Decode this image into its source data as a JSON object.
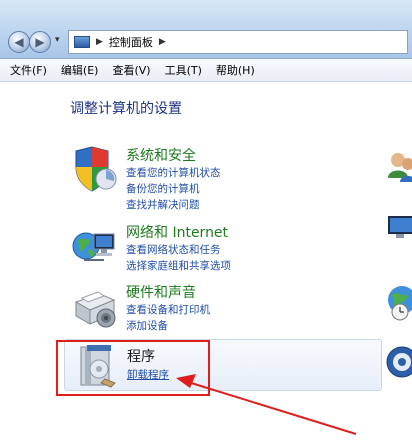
{
  "window": {
    "breadcrumb": "控制面板"
  },
  "menubar": {
    "items": [
      "文件(F)",
      "编辑(E)",
      "查看(V)",
      "工具(T)",
      "帮助(H)"
    ]
  },
  "main": {
    "heading": "调整计算机的设置",
    "categories": [
      {
        "title": "系统和安全",
        "icon": "shield-icon",
        "links": [
          "查看您的计算机状态",
          "备份您的计算机",
          "查找并解决问题"
        ]
      },
      {
        "title": "网络和 Internet",
        "icon": "network-globe-icon",
        "links": [
          "查看网络状态和任务",
          "选择家庭组和共享选项"
        ]
      },
      {
        "title": "硬件和声音",
        "icon": "printer-icon",
        "links": [
          "查看设备和打印机",
          "添加设备"
        ]
      },
      {
        "title": "程序",
        "icon": "programs-icon",
        "links": [
          "卸载程序"
        ]
      }
    ]
  },
  "colors": {
    "annotation": "#e01e1e",
    "link": "#1f4ea6",
    "category_title": "#1e7a1e"
  }
}
